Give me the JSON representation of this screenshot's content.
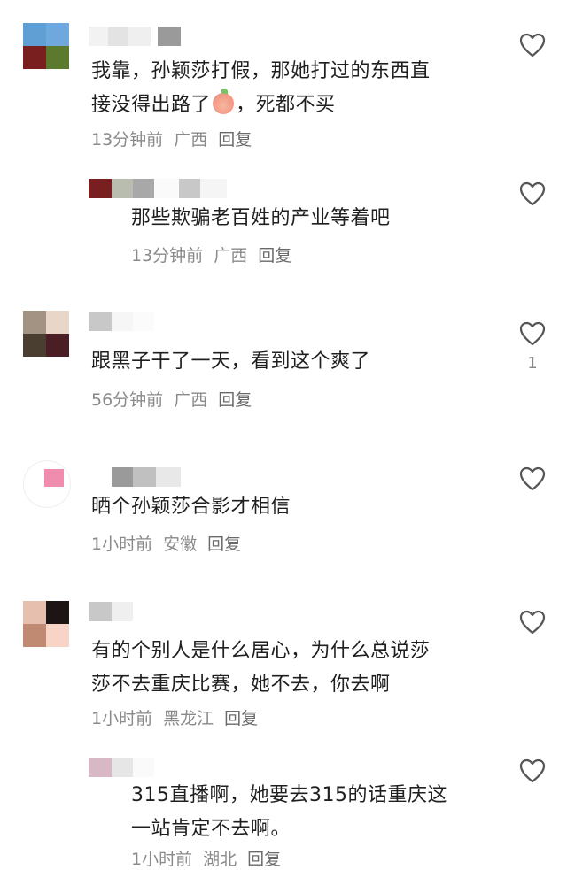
{
  "colors": {
    "text": "#1f1f1f",
    "meta": "#8a8a8a",
    "heart_outline": "#555555"
  },
  "comments": [
    {
      "text_lines": [
        "我靠，孙颖莎打假，那她打过的东西直",
        "接没得出路了"
      ],
      "text_tail": "，死都不买",
      "emoji": "peach-face-emoji",
      "time": "13分钟前",
      "location": "广西",
      "reply": "回复",
      "likes": ""
    },
    {
      "text_lines": [
        "那些欺骗老百姓的产业等着吧"
      ],
      "time": "13分钟前",
      "location": "广西",
      "reply": "回复",
      "likes": ""
    },
    {
      "text_lines": [
        "跟黑子干了一天，看到这个爽了"
      ],
      "time": "56分钟前",
      "location": "广西",
      "reply": "回复",
      "likes": "1"
    },
    {
      "text_lines": [
        "晒个孙颖莎合影才相信"
      ],
      "time": "1小时前",
      "location": "安徽",
      "reply": "回复",
      "likes": ""
    },
    {
      "text_lines": [
        "有的个别人是什么居心，为什么总说莎",
        "莎不去重庆比赛，她不去，你去啊"
      ],
      "time": "1小时前",
      "location": "黑龙江",
      "reply": "回复",
      "likes": ""
    },
    {
      "text_lines": [
        "315直播啊，她要去315的话重庆这",
        "一站肯定不去啊。"
      ],
      "time": "1小时前",
      "location": "湖北",
      "reply": "回复",
      "likes": ""
    }
  ]
}
